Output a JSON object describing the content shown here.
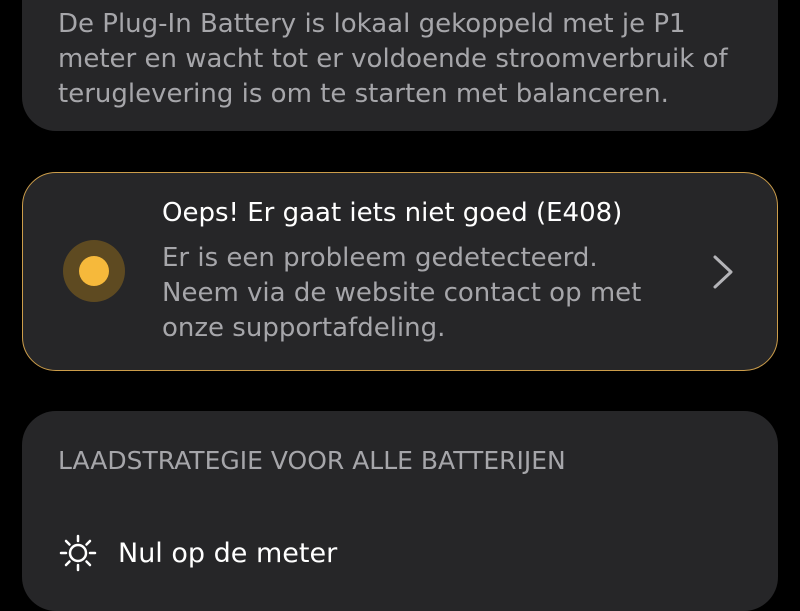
{
  "battery_info": {
    "text": "De Plug-In Battery is lokaal gekoppeld met je P1 meter en wacht tot er voldoende stroomverbruik of teruglevering is om te starten met balanceren."
  },
  "alert": {
    "title": "Oeps! Er gaat iets niet goed (E408)",
    "body": "Er is een probleem gedetecteerd. Neem via de website contact op met onze supportafdeling.",
    "status_color": "#f6b93b",
    "border_color": "#cc9d4a",
    "icon": "chevron-right-icon"
  },
  "strategy": {
    "title": "LAADSTRATEGIE VOOR ALLE BATTERIJEN",
    "option_label": "Nul op de meter",
    "option_icon": "sun-icon"
  }
}
